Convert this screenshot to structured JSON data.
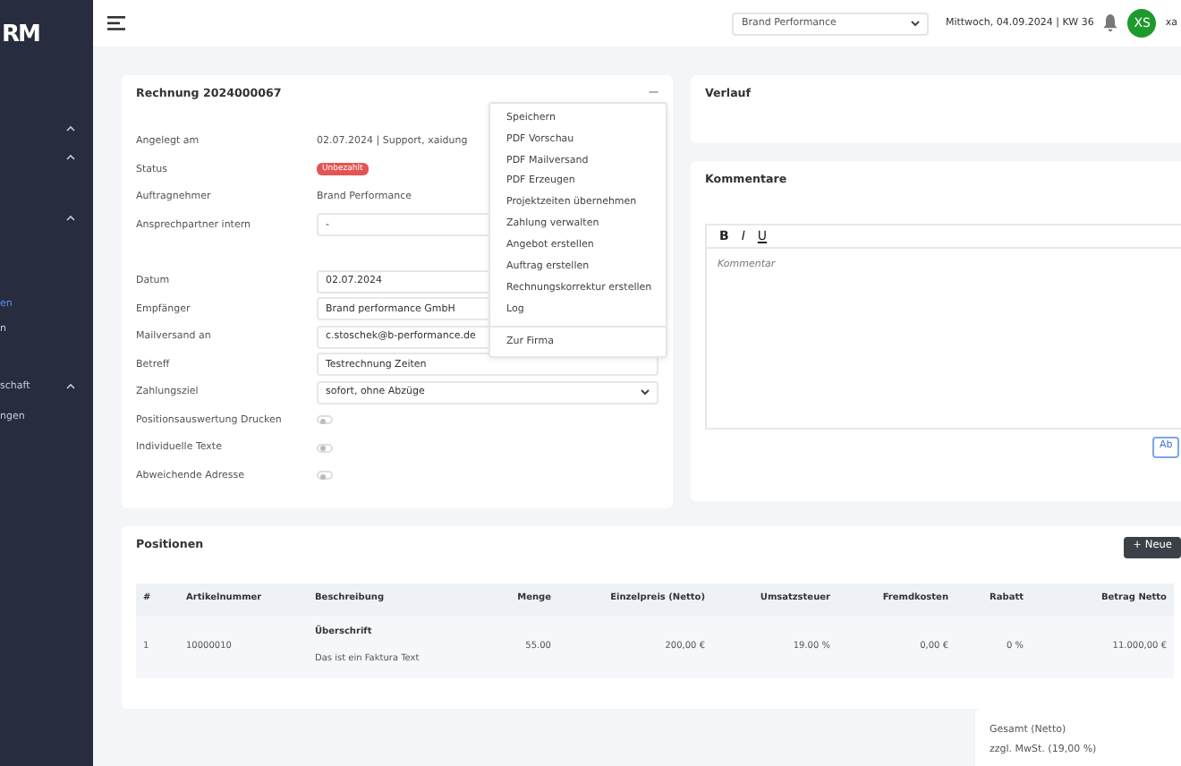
{
  "sidebar": {
    "logo": "RM",
    "items": [
      {
        "kind": "group",
        "selected": false
      },
      {
        "kind": "group",
        "selected": false
      },
      {
        "kind": "group",
        "selected": false
      },
      {
        "kind": "link",
        "label": "en",
        "selected": true
      },
      {
        "kind": "link",
        "label": "n",
        "selected": false
      },
      {
        "kind": "group",
        "label": "schaft",
        "selected": false
      },
      {
        "kind": "link",
        "label": "ngen",
        "selected": false
      }
    ]
  },
  "topbar": {
    "company": "Brand Performance",
    "date": "Mittwoch, 04.09.2024 | KW 36",
    "avatar": "XS",
    "user": "xa"
  },
  "invoice": {
    "title": "Rechnung 2024000067",
    "collapse": "—",
    "fields": [
      {
        "kind": "text",
        "label": "Angelegt am",
        "value": "02.07.2024 | Support, xaidung"
      },
      {
        "kind": "badge",
        "label": "Status",
        "value": "Unbezahlt"
      },
      {
        "kind": "text",
        "label": "Auftragnehmer",
        "value": "Brand Performance"
      },
      {
        "kind": "input",
        "label": "Ansprechpartner intern",
        "value": "-"
      },
      {
        "kind": "gap"
      },
      {
        "kind": "input",
        "label": "Datum",
        "value": "02.07.2024"
      },
      {
        "kind": "input",
        "label": "Empfänger",
        "value": "Brand performance GmbH"
      },
      {
        "kind": "input",
        "label": "Mailversand an",
        "value": "c.stoschek@b-performance.de"
      },
      {
        "kind": "input",
        "label": "Betreff",
        "value": "Testrechnung Zeiten"
      },
      {
        "kind": "select",
        "label": "Zahlungsziel",
        "value": "sofort, ohne Abzüge"
      },
      {
        "kind": "switch",
        "label": "Positionsauswertung Drucken",
        "checked": false
      },
      {
        "kind": "switch",
        "label": "Individuelle Texte",
        "checked": false
      },
      {
        "kind": "switch",
        "label": "Abweichende Adresse",
        "checked": false
      }
    ]
  },
  "menu": {
    "sections": [
      [
        "Speichern",
        "PDF Vorschau",
        "PDF Mailversand",
        "PDF Erzeugen",
        "Projektzeiten übernehmen",
        "Zahlung verwalten",
        "Angebot erstellen",
        "Auftrag erstellen",
        "Rechnungskorrektur erstellen",
        "Log"
      ],
      [
        "Zur Firma"
      ]
    ]
  },
  "history": {
    "title": "Verlauf"
  },
  "comments": {
    "title": "Kommentare",
    "toolbar": [
      "B",
      "I",
      "U"
    ],
    "placeholder": "Kommentar",
    "button": "Ab"
  },
  "positions": {
    "title": "Positionen",
    "button_icon": "+",
    "button": "Neue",
    "columns": [
      "#",
      "Artikelnummer",
      "Beschreibung",
      "Menge",
      "Einzelpreis (Netto)",
      "Umsatzsteuer",
      "Fremdkosten",
      "Rabatt",
      "Betrag Netto"
    ],
    "rows": [
      {
        "cells": [
          "1",
          "10000010",
          {
            "heading": "Überschrift",
            "text": "Das ist ein Faktura Text"
          },
          "55.00",
          "200,00 €",
          "19.00 %",
          "0,00 €",
          "0 %",
          "11.000,00 €"
        ]
      }
    ]
  },
  "totals": [
    "Gesamt (Netto)",
    "zzgl. MwSt. (19,00 %)"
  ]
}
